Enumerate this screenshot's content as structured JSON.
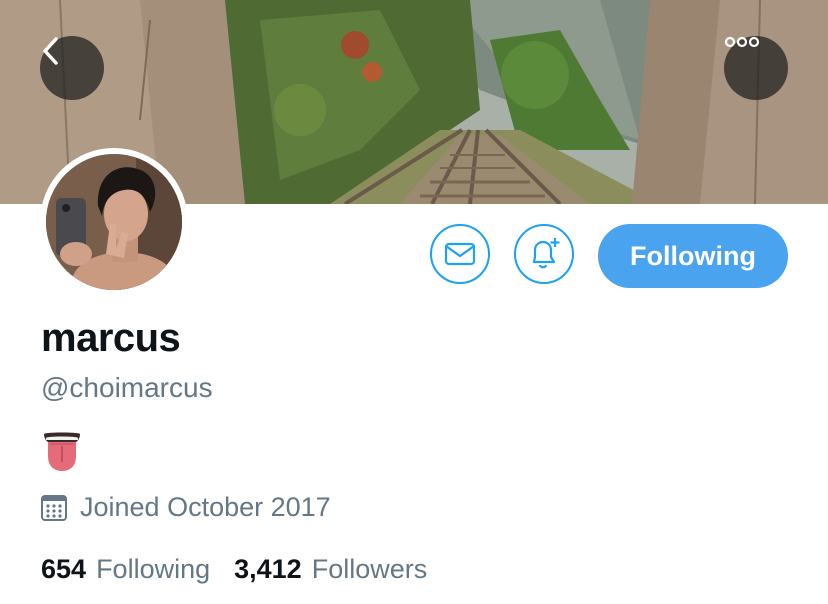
{
  "profile": {
    "display_name": "marcus",
    "handle": "@choimarcus",
    "joined_text": "Joined October 2017",
    "bio_emoji": "tongue-emoji"
  },
  "actions": {
    "follow_label": "Following",
    "message_icon": "mail-icon",
    "notify_icon": "bell-plus-icon"
  },
  "nav": {
    "back_icon": "chevron-left-icon",
    "more_icon": "more-dots-icon"
  },
  "stats": {
    "following_count": "654",
    "following_label": "Following",
    "followers_count": "3,412",
    "followers_label": "Followers"
  },
  "colors": {
    "accent": "#1da1f2",
    "follow_button": "#4aa3ee",
    "secondary_text": "#657786",
    "primary_text": "#0f1419"
  }
}
